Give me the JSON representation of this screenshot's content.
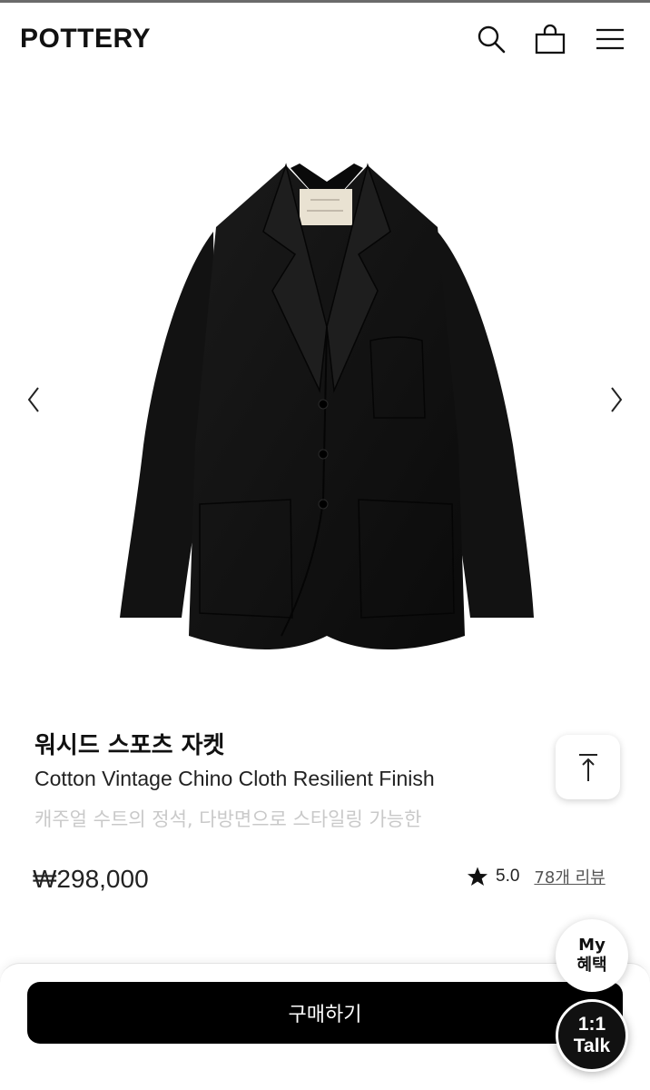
{
  "header": {
    "logo": "POTTERY",
    "icons": [
      "search-icon",
      "shopping-bag-icon",
      "menu-icon"
    ]
  },
  "gallery": {
    "prev_icon": "chevron-left-icon",
    "next_icon": "chevron-right-icon"
  },
  "product": {
    "name": "워시드 스포츠 자켓",
    "subtitle": "Cotton Vintage Chino Cloth Resilient Finish",
    "description": "캐주얼 수트의 정석, 다방면으로 스타일링 가능한",
    "price": "₩298,000",
    "rating": "5.0",
    "review_link": "78개 리뷰"
  },
  "scroll_top_icon": "arrow-up-icon",
  "floating": {
    "benefit_line1": "My",
    "benefit_line2": "혜택",
    "talk_line1": "1:1",
    "talk_line2": "Talk"
  },
  "actions": {
    "buy_label": "구매하기"
  },
  "colors": {
    "primary": "#000000",
    "muted_text": "#c9c9c9",
    "background": "#ffffff"
  }
}
